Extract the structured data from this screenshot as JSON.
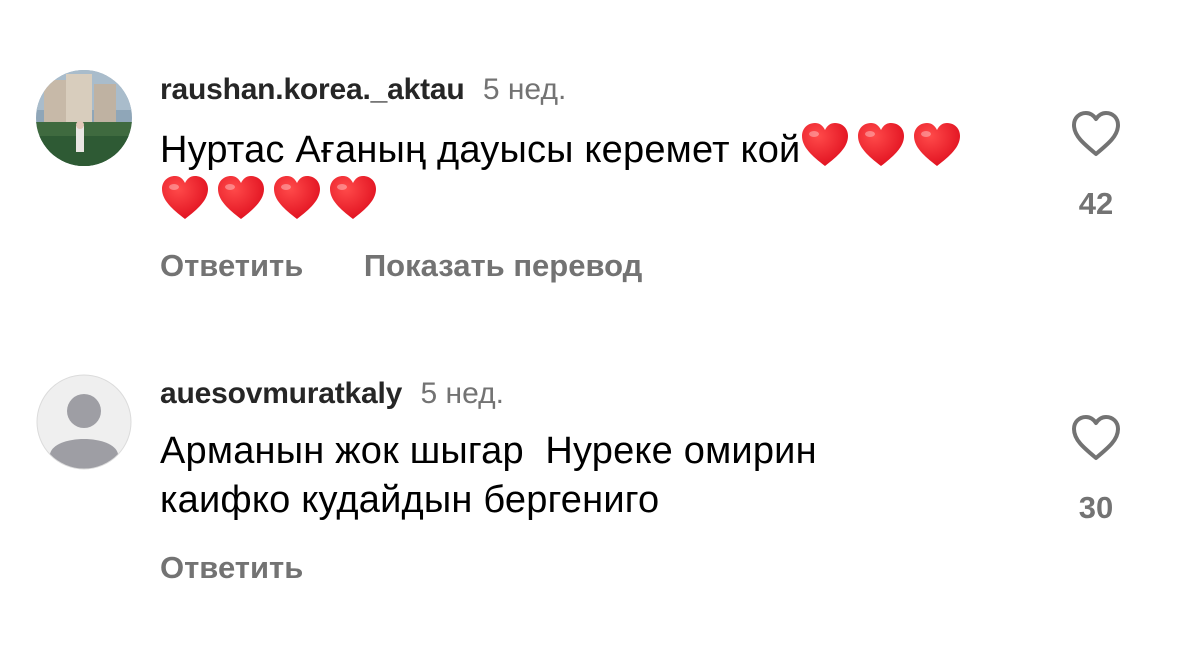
{
  "comments": [
    {
      "username": "raushan.korea._aktau",
      "time": "5 нед.",
      "text_prefix": "Нуртас Ағаның дауысы керемет кой",
      "trailing_hearts": 7,
      "emoji": "red-heart",
      "likes": "42",
      "actions": [
        "Ответить",
        "Показать перевод"
      ],
      "avatar": "photo"
    },
    {
      "username": "auesovmuratkaly",
      "time": "5 нед.",
      "text_lines": [
        "Арманын жок шыгар  Нуреке омирин",
        "каифко кудайдын бергениго"
      ],
      "likes": "30",
      "actions": [
        "Ответить"
      ],
      "avatar": "default"
    }
  ],
  "colors": {
    "username": "#262626",
    "secondary": "#737373",
    "heart": "#e0101f",
    "default_avatar_bg": "#efefef",
    "default_avatar_fg": "#9e9ea4"
  }
}
